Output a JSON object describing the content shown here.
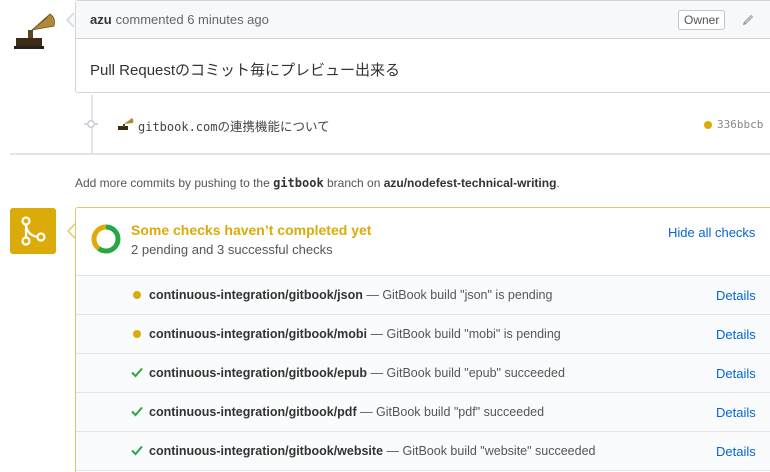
{
  "comment": {
    "author": "azu",
    "meta": "commented 6 minutes ago",
    "badge": "Owner",
    "body": "Pull Requestのコミット毎にプレビュー出来る"
  },
  "commit": {
    "message_mono": "gitbook.com",
    "message_rest": "の連携機能について",
    "sha": "336bbcb"
  },
  "hint": {
    "prefix": "Add more commits by pushing to the ",
    "branch": "gitbook",
    "middle": " branch on ",
    "repo": "azu/nodefest-technical-writing",
    "suffix": "."
  },
  "checks": {
    "title": "Some checks haven’t completed yet",
    "subtitle": "2 pending and 3 successful checks",
    "hide_label": "Hide all checks",
    "pending_count": 2,
    "success_count": 3,
    "colors": {
      "pending": "#dbab09",
      "success": "#28a745"
    },
    "items": [
      {
        "name": "continuous-integration/gitbook/json",
        "desc": " — GitBook build \"json\" is pending",
        "status": "pending",
        "details": "Details"
      },
      {
        "name": "continuous-integration/gitbook/mobi",
        "desc": " — GitBook build \"mobi\" is pending",
        "status": "pending",
        "details": "Details"
      },
      {
        "name": "continuous-integration/gitbook/epub",
        "desc": " — GitBook build \"epub\" succeeded",
        "status": "success",
        "details": "Details"
      },
      {
        "name": "continuous-integration/gitbook/pdf",
        "desc": " — GitBook build \"pdf\" succeeded",
        "status": "success",
        "details": "Details"
      },
      {
        "name": "continuous-integration/gitbook/website",
        "desc": " — GitBook build \"website\" succeeded",
        "status": "success",
        "details": "Details"
      }
    ]
  },
  "icons": {
    "avatar": "gramophone-avatar",
    "edit": "pencil-icon",
    "commit": "commit-icon",
    "merge": "git-merge-icon",
    "ring": "checks-progress-ring",
    "success": "check-icon",
    "pending": "pending-dot"
  }
}
